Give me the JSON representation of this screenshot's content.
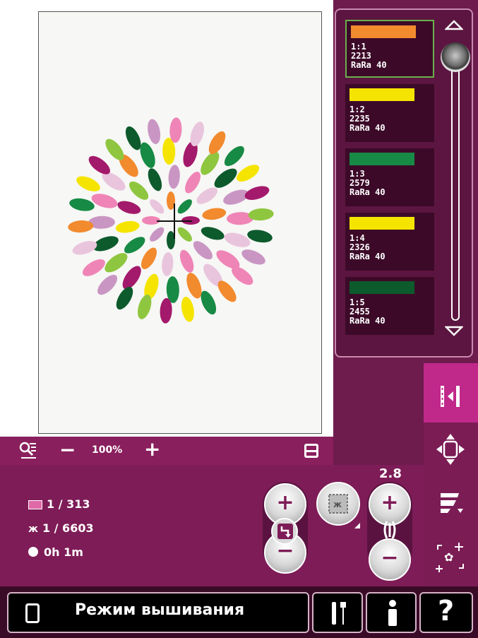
{
  "zoom": {
    "level": "100%",
    "minus": "−",
    "plus": "+"
  },
  "threads": [
    {
      "index": "1:1",
      "number": "2213",
      "brand": "RaRa 40",
      "color": "#f28a2e",
      "selected": true
    },
    {
      "index": "1:2",
      "number": "2235",
      "brand": "RaRa 40",
      "color": "#f5e400",
      "selected": false
    },
    {
      "index": "1:3",
      "number": "2579",
      "brand": "RaRa 40",
      "color": "#178a45",
      "selected": false
    },
    {
      "index": "1:4",
      "number": "2326",
      "brand": "RaRa 40",
      "color": "#f5e400",
      "selected": false
    },
    {
      "index": "1:5",
      "number": "2455",
      "brand": "RaRa 40",
      "color": "#0d5a2c",
      "selected": false
    }
  ],
  "status": {
    "color_block": "1 / 313",
    "stitches": "1 / 6603",
    "time": "0h 1m"
  },
  "stitch_width_value": "2.8",
  "taskbar": {
    "mode_label": "Режим вышивания"
  },
  "icons": {
    "zoom_options": "zoom-options-icon",
    "window_toggle": "window-toggle-icon",
    "jump_to_stitch": "jump-stitch-icon",
    "move_design": "move-design-icon",
    "color_sort": "color-sort-icon",
    "design_position": "design-position-icon",
    "hoop_view": "hoop-view-icon",
    "stitch_back": "stitch-back-icon",
    "mirror": "mirror-icon"
  }
}
